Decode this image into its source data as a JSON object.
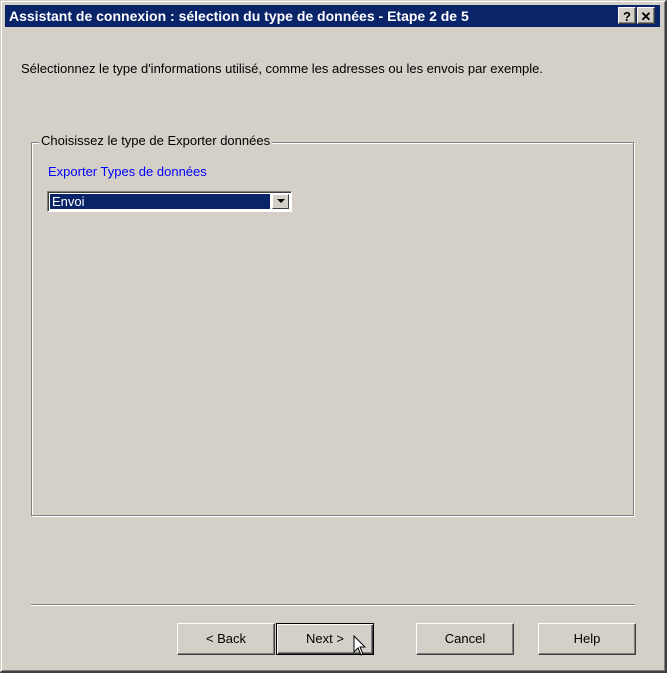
{
  "window": {
    "title": "Assistant de connexion : sélection du type de données - Etape 2 de 5",
    "help_glyph": "?",
    "close_glyph": "✕"
  },
  "intro": {
    "text": "Sélectionnez le type d'informations utilisé, comme les adresses ou les envois par exemple."
  },
  "group": {
    "legend": "Choisissez le type de Exporter données",
    "field_label": "Exporter Types de données",
    "selected_value": "Envoi"
  },
  "buttons": {
    "back": "< Back",
    "next": "Next >",
    "cancel": "Cancel",
    "help": "Help"
  }
}
